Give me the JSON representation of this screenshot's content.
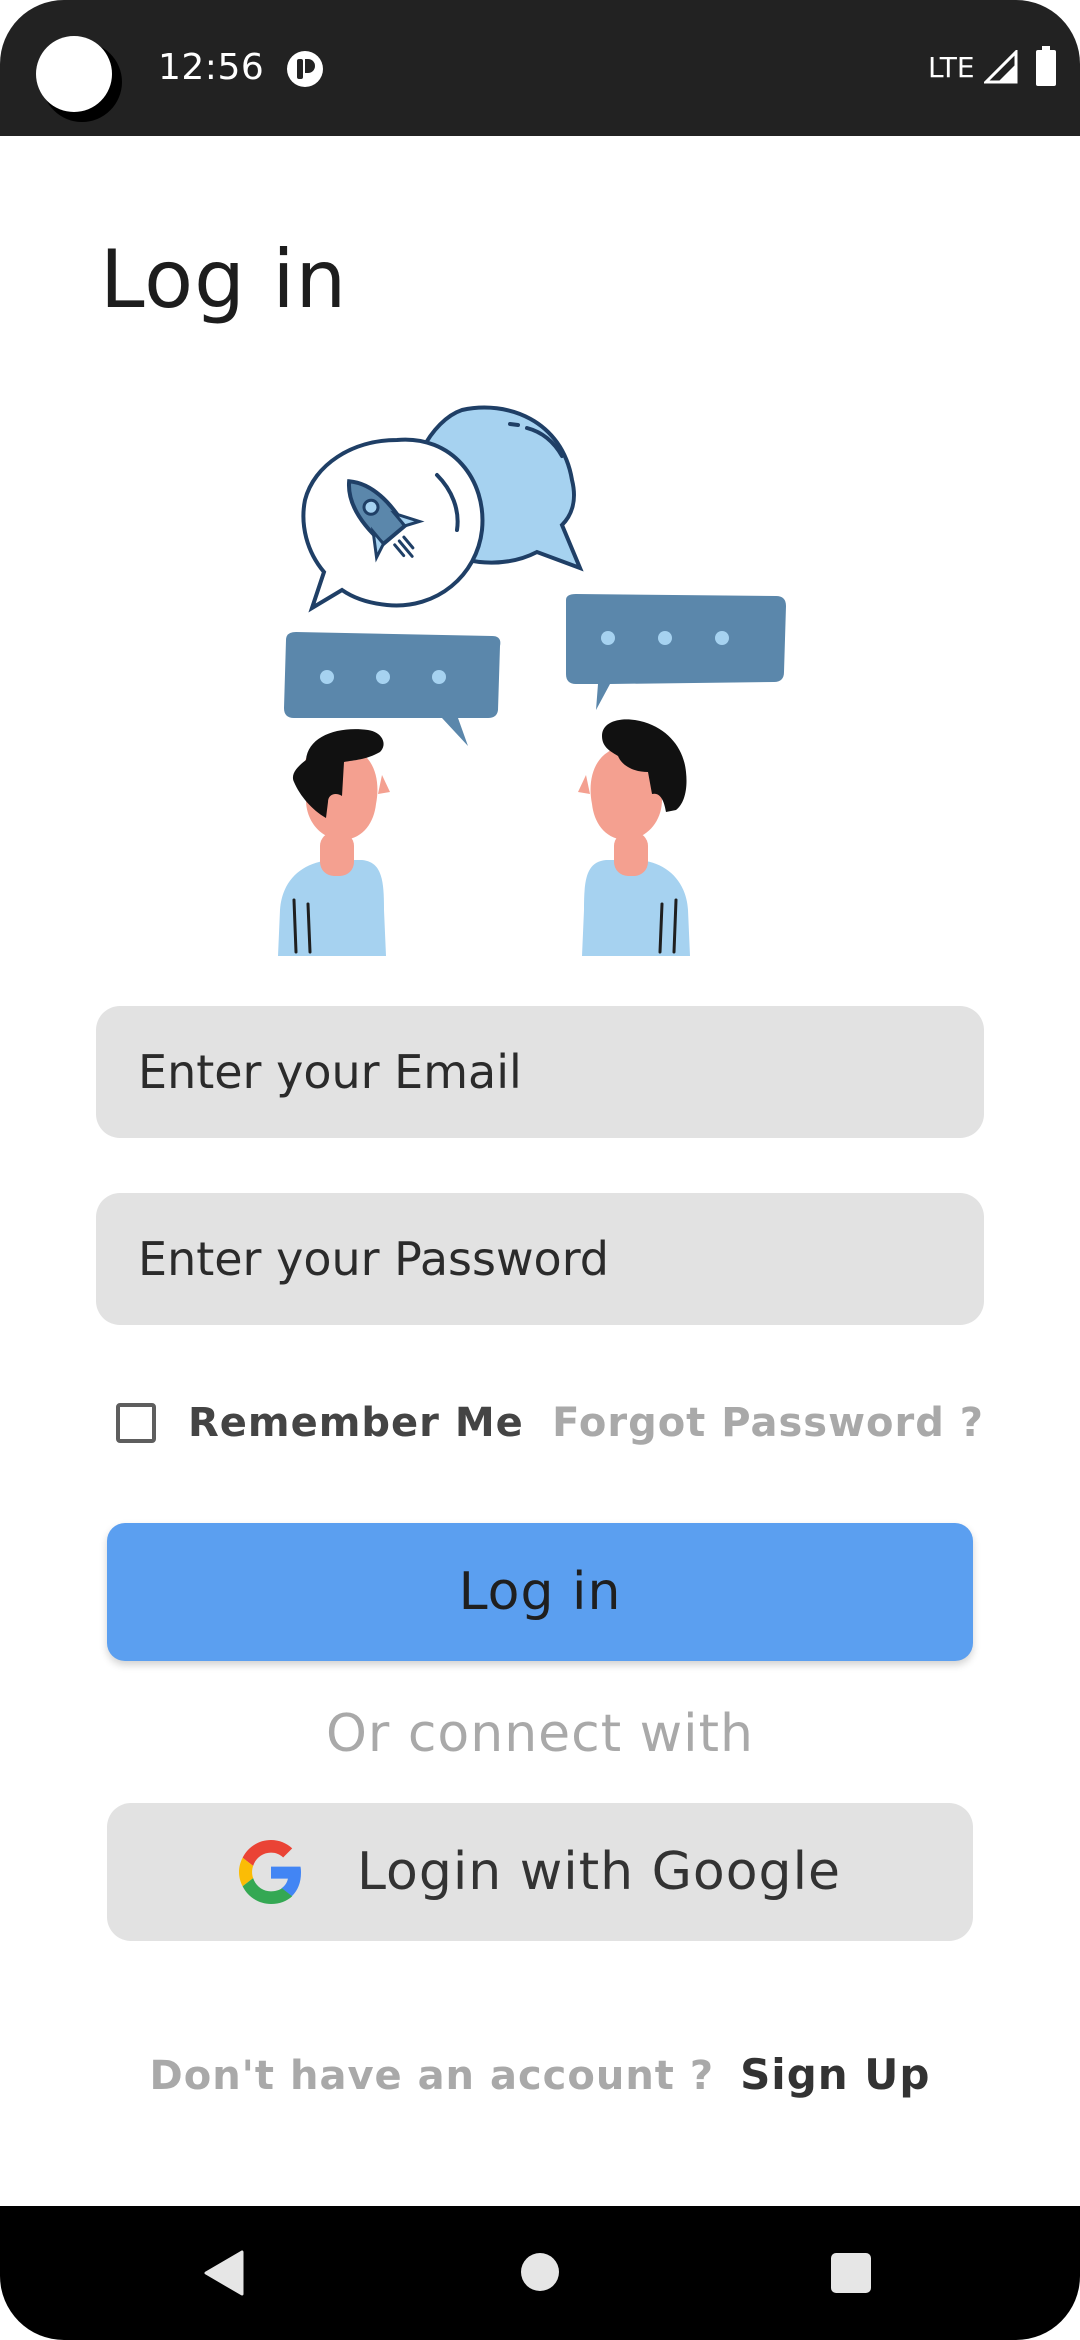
{
  "status_bar": {
    "time": "12:56",
    "network": "LTE",
    "icons": [
      "camera-cutout",
      "app-notification-icon",
      "signal-icon",
      "battery-icon"
    ]
  },
  "page": {
    "title": "Log in"
  },
  "illustration": {
    "icon": "chat-rocket-illustration"
  },
  "form": {
    "email_placeholder": "Enter your Email",
    "email_value": "",
    "password_placeholder": "Enter your Password",
    "password_value": "",
    "remember_label": "Remember Me",
    "remember_checked": false,
    "forgot_label": "Forgot Password ?",
    "login_label": "Log in"
  },
  "social": {
    "connect_text": "Or connect with",
    "google_label": "Login with Google",
    "google_icon": "google-icon"
  },
  "signup": {
    "prompt": "Don't have an account ?",
    "link": "Sign Up"
  },
  "nav_bar": {
    "icons": [
      "back-icon",
      "home-icon",
      "recents-icon"
    ]
  },
  "colors": {
    "primary_button": "#5b9ff0",
    "field_background": "#e2e2e2",
    "muted_text": "#a9a9a9",
    "status_bar": "#222222",
    "illustration_blue": "#5b87ab",
    "illustration_light_blue": "#a6d2f0"
  }
}
